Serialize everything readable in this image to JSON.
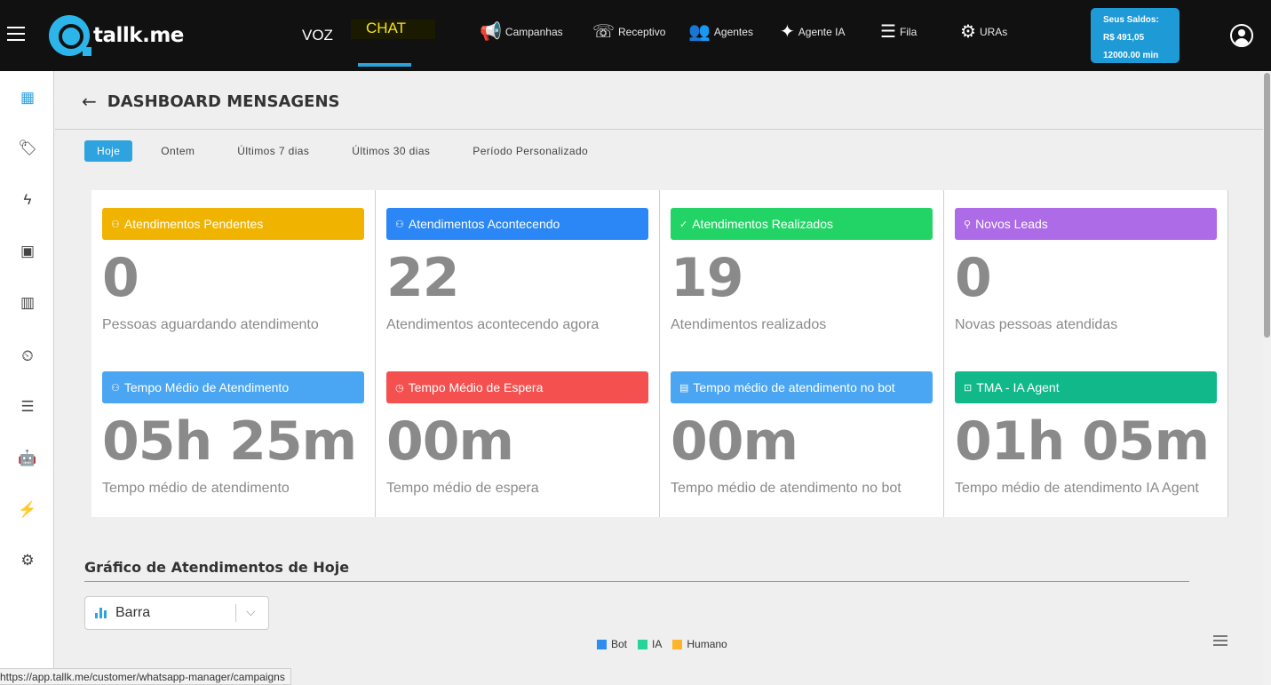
{
  "header": {
    "logo_text": "tallk.me",
    "mode_voz": "VOZ",
    "mode_chat": "CHAT",
    "nav": [
      {
        "label": "Campanhas",
        "icon": "megaphone-icon",
        "glyph": "📢"
      },
      {
        "label": "Receptivo",
        "icon": "phone-incoming-icon",
        "glyph": "☏"
      },
      {
        "label": "Agentes",
        "icon": "people-icon",
        "glyph": "👥"
      },
      {
        "label": "Agente IA",
        "icon": "sparkles-icon",
        "glyph": "✦"
      },
      {
        "label": "Fila",
        "icon": "queue-list-icon",
        "glyph": "☰"
      },
      {
        "label": "URAs",
        "icon": "gear-icon",
        "glyph": "⚙"
      }
    ],
    "saldo": {
      "title": "Seus Saldos:",
      "money": "R$ 491,05",
      "minutes": "12000.00 min"
    }
  },
  "sidebar": {
    "items": [
      {
        "icon": "dashboard-icon",
        "glyph": "▦"
      },
      {
        "icon": "tag-icon",
        "glyph": "🏷"
      },
      {
        "icon": "lightning-icon",
        "glyph": "ϟ"
      },
      {
        "icon": "contact-card-icon",
        "glyph": "▣"
      },
      {
        "icon": "kanban-icon",
        "glyph": "▥"
      },
      {
        "icon": "campaign-clock-icon",
        "glyph": "⏲"
      },
      {
        "icon": "menu-list-icon",
        "glyph": "☰"
      },
      {
        "icon": "robot-icon",
        "glyph": "🤖"
      },
      {
        "icon": "plug-icon",
        "glyph": "⚡"
      },
      {
        "icon": "settings-icon",
        "glyph": "⚙"
      }
    ]
  },
  "page": {
    "title": "DASHBOARD MENSAGENS",
    "periods": [
      "Hoje",
      "Ontem",
      "Últimos 7 dias",
      "Últimos 30 dias",
      "Período Personalizado"
    ],
    "active_period": "Hoje"
  },
  "cards": [
    {
      "label": "Atendimentos Pendentes",
      "value": "0",
      "desc": "Pessoas aguardando atendimento",
      "color": "#f0b400",
      "icon": "users-wait-icon"
    },
    {
      "label": "Atendimentos Acontecendo",
      "value": "22",
      "desc": "Atendimentos acontecendo agora",
      "color": "#2b87f5",
      "icon": "users-chat-icon"
    },
    {
      "label": "Atendimentos Realizados",
      "value": "19",
      "desc": "Atendimentos realizados",
      "color": "#22d466",
      "icon": "user-check-icon"
    },
    {
      "label": "Novos Leads",
      "value": "0",
      "desc": "Novas pessoas atendidas",
      "color": "#ad6be7",
      "icon": "user-icon"
    },
    {
      "label": "Tempo Médio de Atendimento",
      "value": "05h 25m",
      "desc": "Tempo médio de atendimento",
      "color": "#4aa6f2",
      "icon": "user-voice-icon"
    },
    {
      "label": "Tempo Médio de Espera",
      "value": "00m",
      "desc": "Tempo médio de espera",
      "color": "#f4504f",
      "icon": "clock-icon"
    },
    {
      "label": "Tempo médio de atendimento no bot",
      "value": "00m",
      "desc": "Tempo médio de atendimento no bot",
      "color": "#4aa6f2",
      "icon": "bot-chat-icon"
    },
    {
      "label": "TMA - IA Agent",
      "value": "01h 05m",
      "desc": "Tempo médio de atendimento IA Agent",
      "color": "#11b98a",
      "icon": "robot-icon"
    }
  ],
  "chart": {
    "title": "Gráfico de Atendimentos de Hoje",
    "type_select": "Barra",
    "legend": [
      {
        "name": "Bot",
        "color": "#2e8ef0"
      },
      {
        "name": "IA",
        "color": "#28d49a"
      },
      {
        "name": "Humano",
        "color": "#fcb52a"
      }
    ]
  },
  "status_url": "https://app.tallk.me/customer/whatsapp-manager/campaigns"
}
